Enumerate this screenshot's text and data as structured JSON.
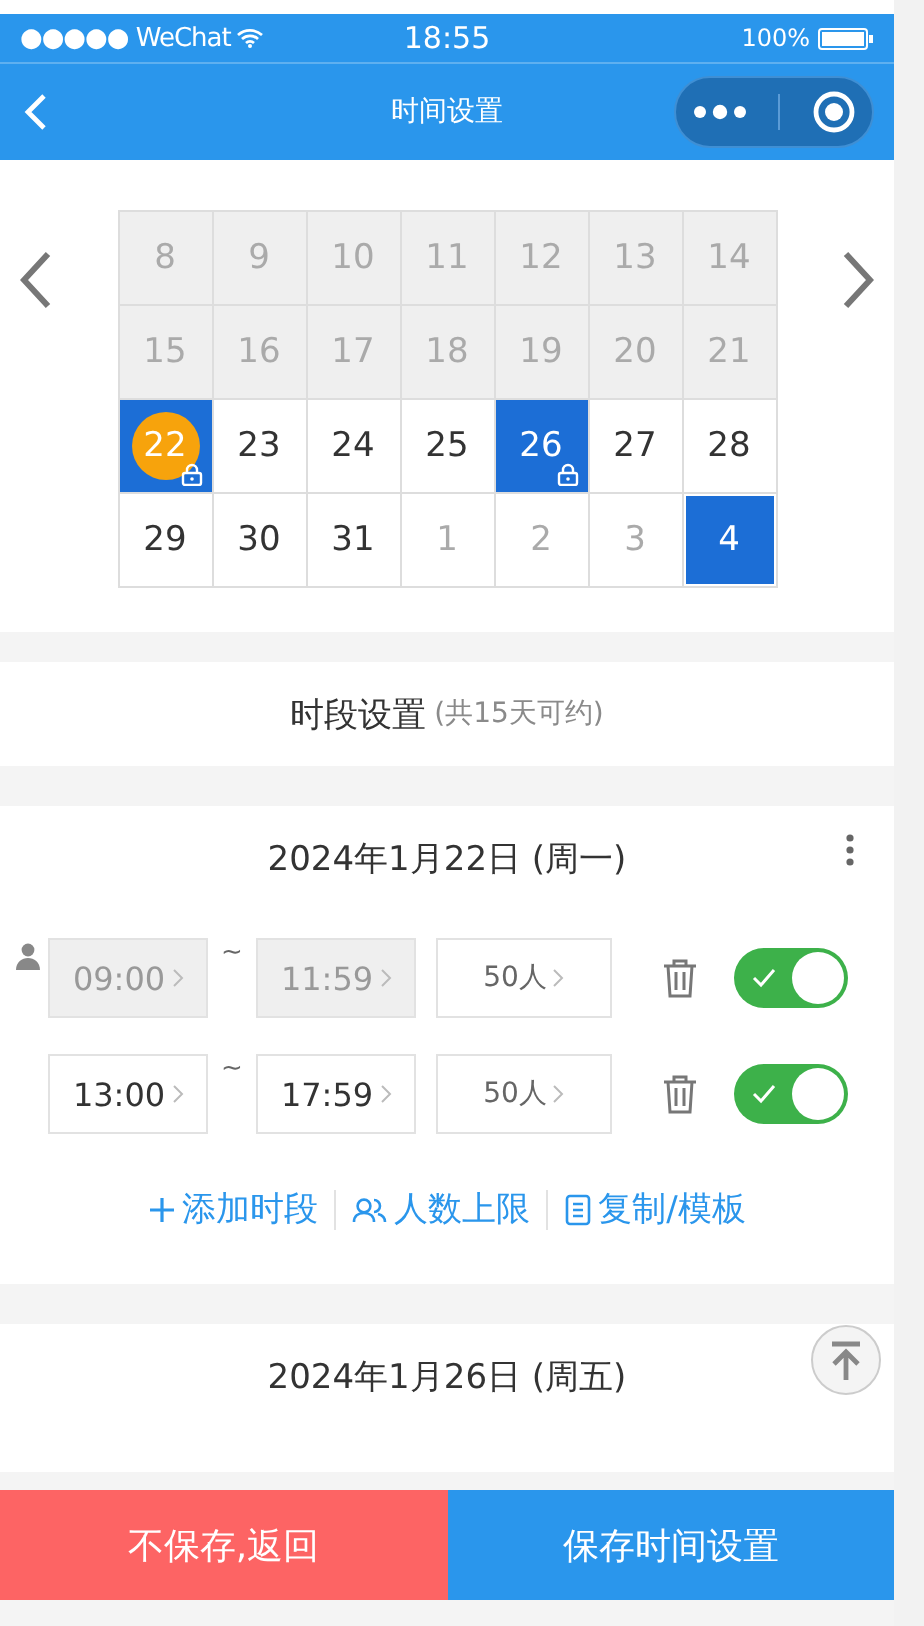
{
  "status_bar": {
    "carrier": "●●●●● WeChat",
    "time": "18:55",
    "battery": "100%"
  },
  "nav": {
    "title": "时间设置"
  },
  "calendar": {
    "weeks": [
      [
        {
          "day": "8",
          "past": true,
          "other_month": false,
          "selected": false,
          "today": false,
          "locked": false
        },
        {
          "day": "9",
          "past": true,
          "other_month": false,
          "selected": false,
          "today": false,
          "locked": false
        },
        {
          "day": "10",
          "past": true,
          "other_month": false,
          "selected": false,
          "today": false,
          "locked": false
        },
        {
          "day": "11",
          "past": true,
          "other_month": false,
          "selected": false,
          "today": false,
          "locked": false
        },
        {
          "day": "12",
          "past": true,
          "other_month": false,
          "selected": false,
          "today": false,
          "locked": false
        },
        {
          "day": "13",
          "past": true,
          "other_month": false,
          "selected": false,
          "today": false,
          "locked": false
        },
        {
          "day": "14",
          "past": true,
          "other_month": false,
          "selected": false,
          "today": false,
          "locked": false
        }
      ],
      [
        {
          "day": "15",
          "past": true,
          "other_month": false,
          "selected": false,
          "today": false,
          "locked": false
        },
        {
          "day": "16",
          "past": true,
          "other_month": false,
          "selected": false,
          "today": false,
          "locked": false
        },
        {
          "day": "17",
          "past": true,
          "other_month": false,
          "selected": false,
          "today": false,
          "locked": false
        },
        {
          "day": "18",
          "past": true,
          "other_month": false,
          "selected": false,
          "today": false,
          "locked": false
        },
        {
          "day": "19",
          "past": true,
          "other_month": false,
          "selected": false,
          "today": false,
          "locked": false
        },
        {
          "day": "20",
          "past": true,
          "other_month": false,
          "selected": false,
          "today": false,
          "locked": false
        },
        {
          "day": "21",
          "past": true,
          "other_month": false,
          "selected": false,
          "today": false,
          "locked": false
        }
      ],
      [
        {
          "day": "22",
          "past": false,
          "other_month": false,
          "selected": true,
          "today": true,
          "locked": true
        },
        {
          "day": "23",
          "past": false,
          "other_month": false,
          "selected": false,
          "today": false,
          "locked": false
        },
        {
          "day": "24",
          "past": false,
          "other_month": false,
          "selected": false,
          "today": false,
          "locked": false
        },
        {
          "day": "25",
          "past": false,
          "other_month": false,
          "selected": false,
          "today": false,
          "locked": false
        },
        {
          "day": "26",
          "past": false,
          "other_month": false,
          "selected": true,
          "today": false,
          "locked": true
        },
        {
          "day": "27",
          "past": false,
          "other_month": false,
          "selected": false,
          "today": false,
          "locked": false
        },
        {
          "day": "28",
          "past": false,
          "other_month": false,
          "selected": false,
          "today": false,
          "locked": false
        }
      ],
      [
        {
          "day": "29",
          "past": false,
          "other_month": false,
          "selected": false,
          "today": false,
          "locked": false
        },
        {
          "day": "30",
          "past": false,
          "other_month": false,
          "selected": false,
          "today": false,
          "locked": false
        },
        {
          "day": "31",
          "past": false,
          "other_month": false,
          "selected": false,
          "today": false,
          "locked": false
        },
        {
          "day": "1",
          "past": false,
          "other_month": true,
          "selected": false,
          "today": false,
          "locked": false
        },
        {
          "day": "2",
          "past": false,
          "other_month": true,
          "selected": false,
          "today": false,
          "locked": false
        },
        {
          "day": "3",
          "past": false,
          "other_month": true,
          "selected": false,
          "today": false,
          "locked": false
        },
        {
          "day": "4",
          "past": false,
          "other_month": true,
          "selected": true,
          "today": false,
          "locked": false
        }
      ]
    ]
  },
  "period_header": {
    "title": "时段设置",
    "note": "(共15天可约)"
  },
  "days": [
    {
      "date": "2024年1月22日 (周一)",
      "slots": [
        {
          "start": "09:00",
          "separator": "~",
          "end": "11:59",
          "capacity": "50人",
          "disabled": true,
          "booked": true,
          "on": true
        },
        {
          "start": "13:00",
          "separator": "~",
          "end": "17:59",
          "capacity": "50人",
          "disabled": false,
          "booked": false,
          "on": true
        }
      ],
      "actions": [
        {
          "label": "添加时段",
          "kind": "add"
        },
        {
          "label": "人数上限",
          "kind": "limit"
        },
        {
          "label": "复制/模板",
          "kind": "copy"
        }
      ]
    },
    {
      "date": "2024年1月26日 (周五)"
    }
  ],
  "buttons": [
    {
      "label": "不保存,返回",
      "kind": "cancel"
    },
    {
      "label": "保存时间设置",
      "kind": "save"
    }
  ]
}
